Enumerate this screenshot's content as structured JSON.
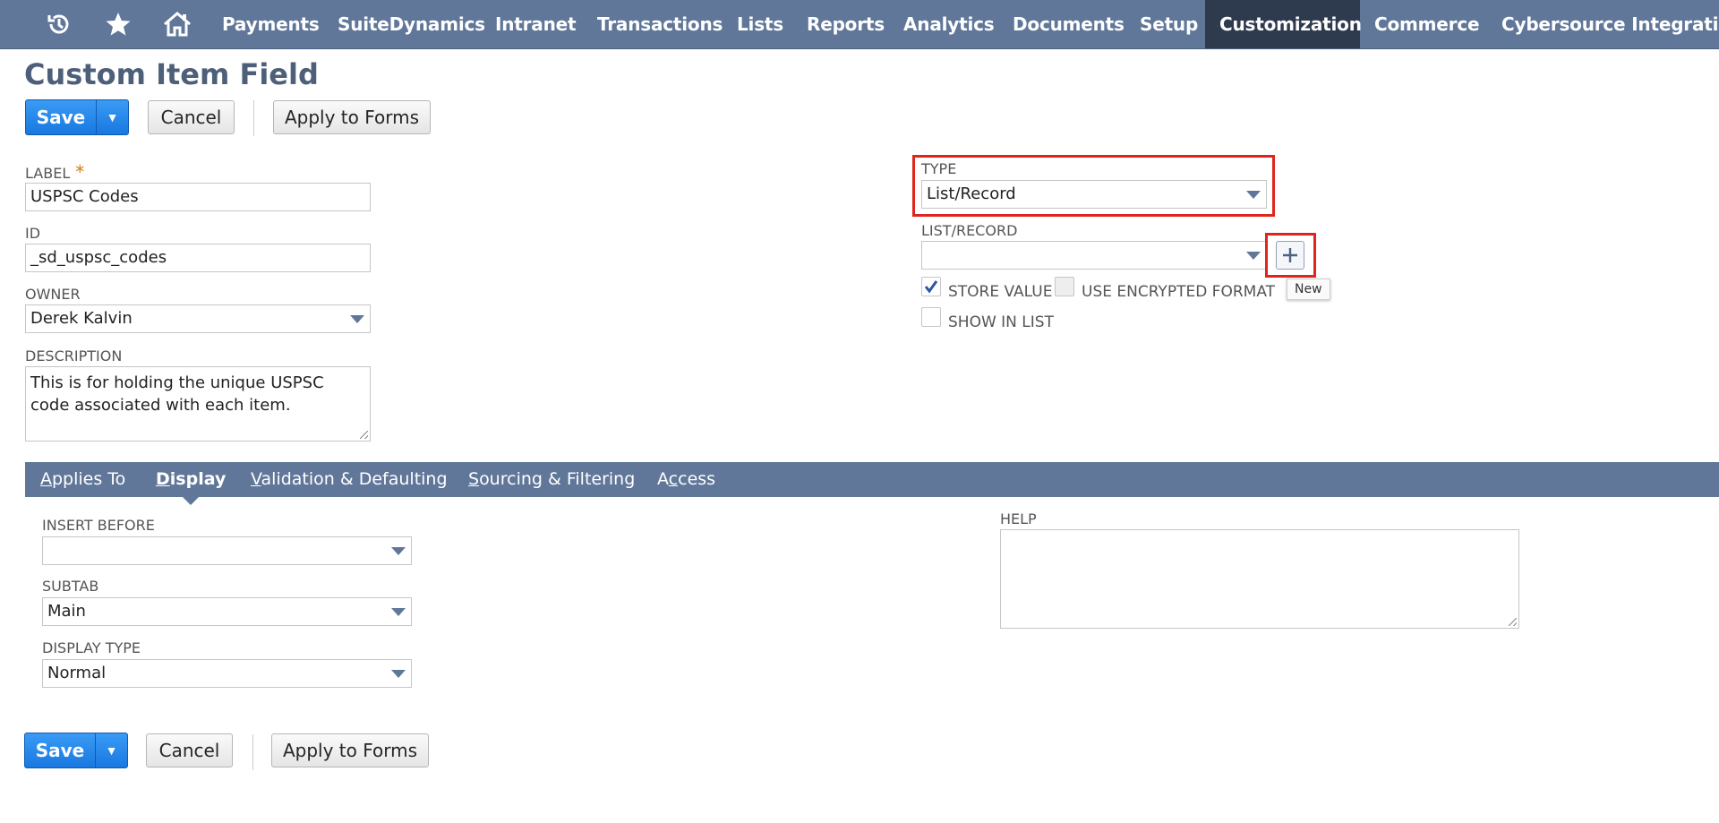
{
  "nav": {
    "icons": [
      "recent-records-icon",
      "favorites-star-icon",
      "home-icon"
    ],
    "items": [
      {
        "label": "Payments"
      },
      {
        "label": "SuiteDynamics"
      },
      {
        "label": "Intranet"
      },
      {
        "label": "Transactions"
      },
      {
        "label": "Lists"
      },
      {
        "label": "Reports"
      },
      {
        "label": "Analytics"
      },
      {
        "label": "Documents"
      },
      {
        "label": "Setup"
      },
      {
        "label": "Customization",
        "active": true
      },
      {
        "label": "Commerce"
      },
      {
        "label": "Cybersource Integration"
      }
    ]
  },
  "page": {
    "title": "Custom Item Field"
  },
  "toolbar": {
    "save_label": "Save",
    "cancel_label": "Cancel",
    "apply_label": "Apply to Forms"
  },
  "form": {
    "label": {
      "caption": "LABEL",
      "required_mark": "*",
      "value": "USPSC Codes"
    },
    "id": {
      "caption": "ID",
      "value": "_sd_uspsc_codes"
    },
    "owner": {
      "caption": "OWNER",
      "value": "Derek Kalvin"
    },
    "description": {
      "caption": "DESCRIPTION",
      "value": "This is for holding the unique USPSC code associated with each item."
    },
    "type": {
      "caption": "TYPE",
      "value": "List/Record"
    },
    "list_record": {
      "caption": "LIST/RECORD",
      "value": "",
      "new_tooltip": "New"
    },
    "store_value": {
      "label": "STORE VALUE",
      "checked": true
    },
    "use_encrypted": {
      "label": "USE ENCRYPTED FORMAT",
      "checked": false,
      "disabled": true
    },
    "show_in_list": {
      "label": "SHOW IN LIST",
      "checked": false
    }
  },
  "subtabs": [
    {
      "key": "A",
      "rest": "pplies To"
    },
    {
      "key": "D",
      "rest": "isplay",
      "active": true
    },
    {
      "key": "V",
      "rest": "alidation & Defaulting"
    },
    {
      "key": "S",
      "rest": "ourcing & Filtering"
    },
    {
      "pre": "A",
      "key": "c",
      "rest": "cess"
    }
  ],
  "display": {
    "insert_before": {
      "caption": "INSERT BEFORE",
      "value": ""
    },
    "subtab": {
      "caption": "SUBTAB",
      "value": "Main"
    },
    "display_type": {
      "caption": "DISPLAY TYPE",
      "value": "Normal"
    },
    "help": {
      "caption": "HELP",
      "value": ""
    }
  },
  "colors": {
    "nav_bg": "#607799",
    "nav_active": "#2e3b4e",
    "primary_button": "#1878e0",
    "highlight_red": "#e0261c",
    "title_color": "#4d5f79"
  }
}
